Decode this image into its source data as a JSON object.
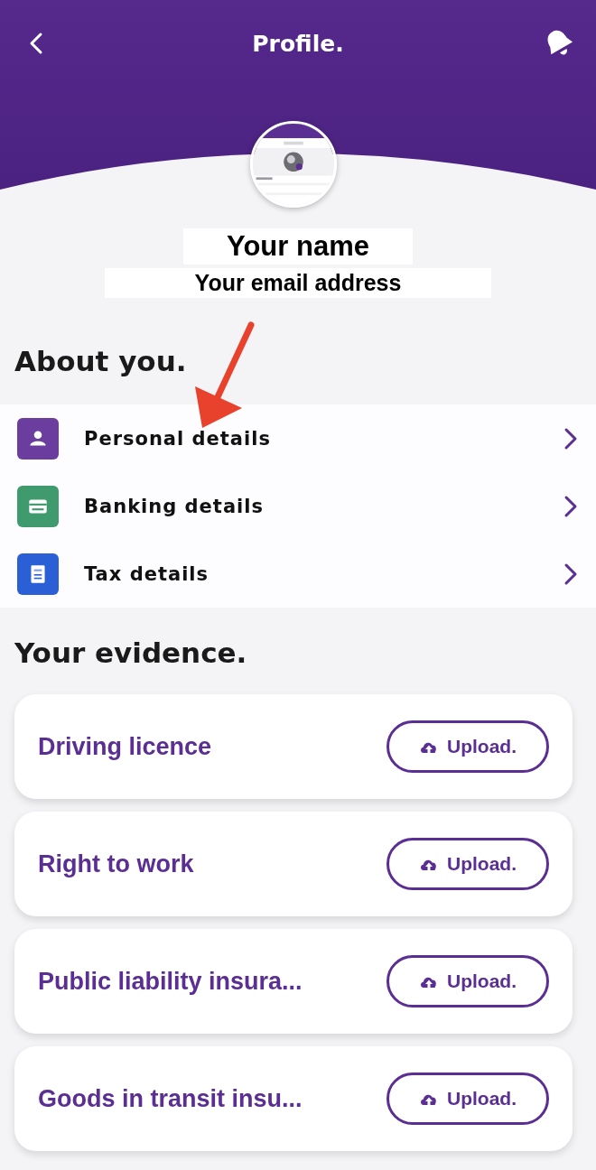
{
  "header": {
    "title": "Profile."
  },
  "profile": {
    "name": "Your name",
    "email": "Your email address"
  },
  "about": {
    "heading": "About you.",
    "items": [
      {
        "label": "Personal details",
        "kind": "person",
        "color": "#6a3d9e"
      },
      {
        "label": "Banking details",
        "kind": "card",
        "color": "#3f9a6e"
      },
      {
        "label": "Tax details",
        "kind": "document",
        "color": "#2b5fd6"
      }
    ]
  },
  "evidence": {
    "heading": "Your evidence.",
    "items": [
      {
        "title": "Driving licence",
        "button": "Upload."
      },
      {
        "title": "Right to work",
        "button": "Upload."
      },
      {
        "title": "Public liability insura...",
        "button": "Upload."
      },
      {
        "title": "Goods in transit insu...",
        "button": "Upload."
      }
    ]
  }
}
